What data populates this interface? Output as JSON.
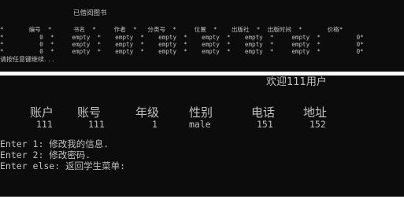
{
  "top_panel": {
    "title": "已借阅图书",
    "header_row": "*       编号  *      书名  *     作者  *   分类号  *     位置  *    出版社  *  出版时间  *       价格*",
    "rows": [
      "*          0  *     empty  *    empty  *    empty  *    empty  *    empty  *     empty  *          0*",
      "*          0  *     empty  *    empty  *    empty  *    empty  *    empty  *     empty  *          0*",
      "*          0  *     empty  *    empty  *    empty  *    empty  *    empty  *     empty  *          0*"
    ],
    "hint": "请按任意键继续. . ."
  },
  "bottom_panel": {
    "welcome": "欢迎111用户",
    "headers": [
      "账户",
      "账号",
      "年级",
      "性别",
      "电话",
      "地址"
    ],
    "values": [
      "111",
      "111",
      "1",
      "male",
      "151",
      "152"
    ],
    "menu": [
      "Enter 1: 修改我的信息.",
      "Enter 2: 修改密码.",
      "Enter else: 返回学生菜单:"
    ]
  },
  "colors": {
    "terminal_bg": "#0c0c0c",
    "terminal_text": "#c0c0c0",
    "divider": "#ffffff"
  }
}
